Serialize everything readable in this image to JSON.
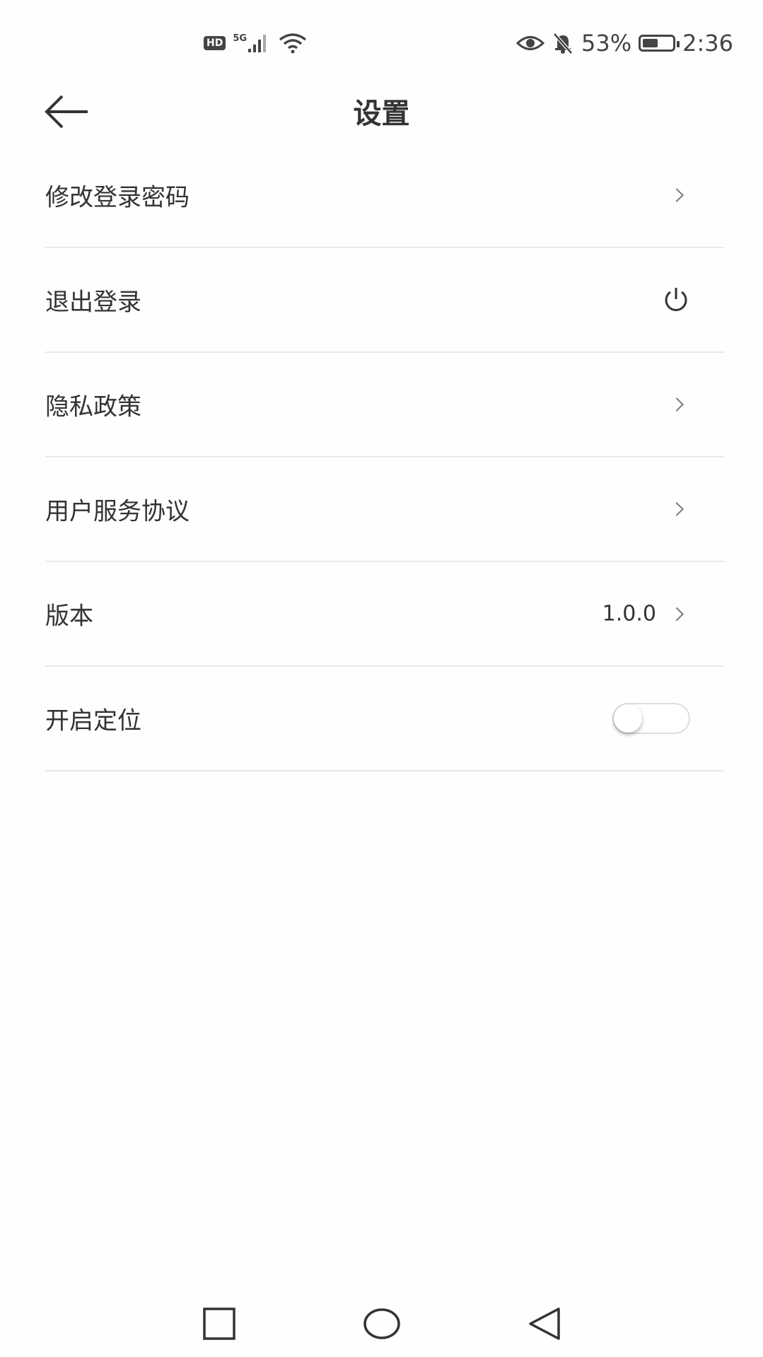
{
  "status_bar": {
    "hd": "HD",
    "network": "5G",
    "battery_percent": "53%",
    "battery_level": 0.53,
    "time": "2:36"
  },
  "header": {
    "title": "设置"
  },
  "menu": {
    "items": [
      {
        "label": "修改登录密码",
        "value": "",
        "right": "chevron-right-icon"
      },
      {
        "label": "退出登录",
        "value": "",
        "right": "power-icon"
      },
      {
        "label": "隐私政策",
        "value": "",
        "right": "chevron-right-icon"
      },
      {
        "label": "用户服务协议",
        "value": "",
        "right": "chevron-right-icon"
      },
      {
        "label": "版本",
        "value": "1.0.0",
        "right": "chevron-right-icon"
      },
      {
        "label": "开启定位",
        "value": "",
        "right": "toggle",
        "toggle_on": false
      }
    ]
  },
  "nav_bar": {
    "buttons": [
      "square-icon",
      "circle-icon",
      "triangle-back-icon"
    ]
  }
}
